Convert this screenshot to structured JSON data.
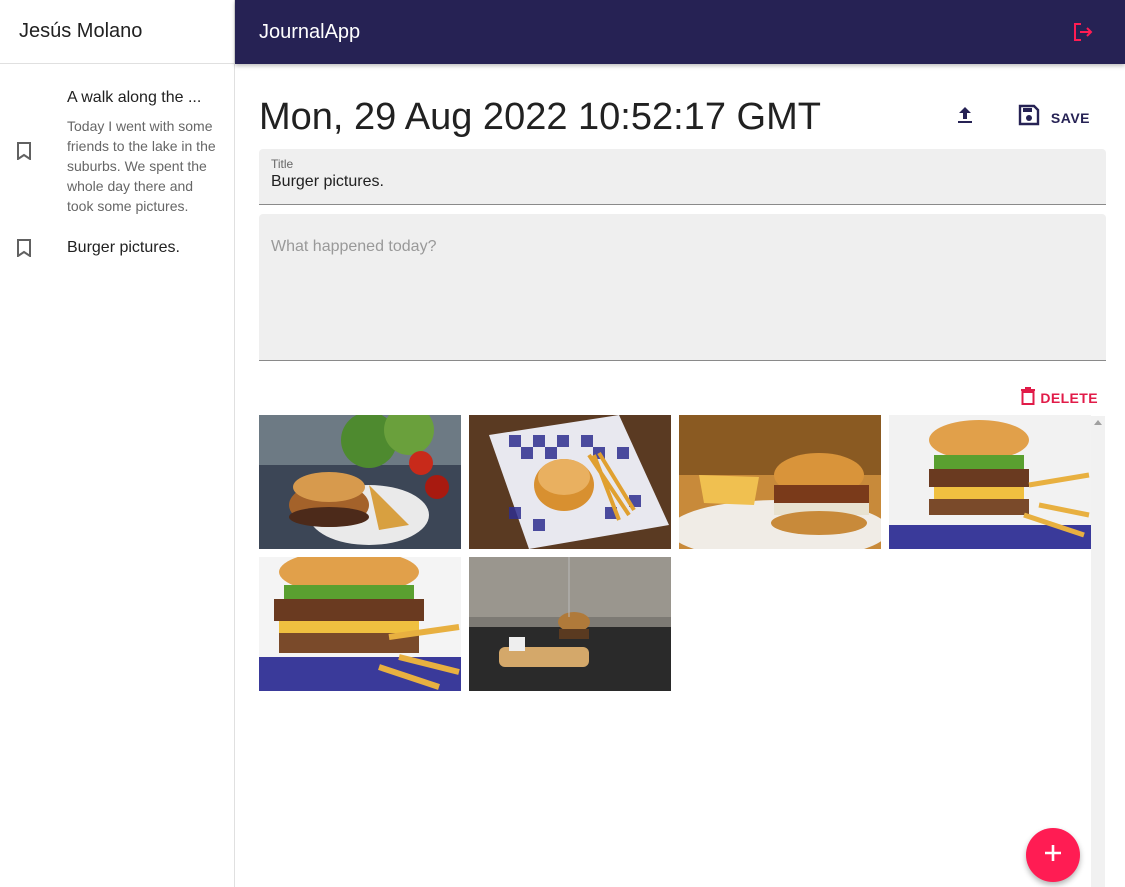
{
  "sidebar": {
    "user_name": "Jesús Molano",
    "notes": [
      {
        "title": "A walk along the ...",
        "body": "Today I went with some friends to the lake in the suburbs. We spent the whole day there and took some pictures."
      },
      {
        "title": "Burger pictures.",
        "body": ""
      }
    ]
  },
  "appbar": {
    "title": "JournalApp",
    "logout_icon": "logout-icon"
  },
  "note": {
    "date": "Mon, 29 Aug 2022 10:52:17 GMT",
    "save_label": "SAVE",
    "title_label": "Title",
    "title_value": "Burger pictures.",
    "body_placeholder": "What happened today?",
    "delete_label": "DELETE"
  },
  "gallery": {
    "images": [
      "burger-plate-tomatoes",
      "burger-checkered-paper",
      "burger-fries-plate",
      "stacked-burger-fries",
      "stacked-burger-closeup",
      "burger-on-board"
    ]
  },
  "colors": {
    "appbar": "#262254",
    "accent": "#ff1c53",
    "delete": "#e11b48"
  }
}
